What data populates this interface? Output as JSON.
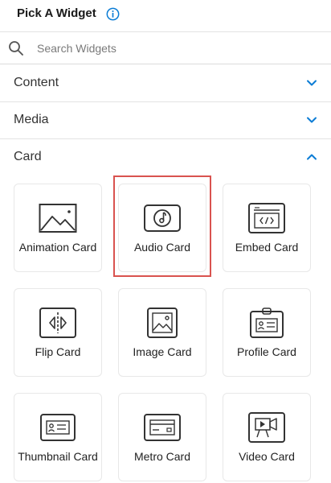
{
  "header": {
    "title": "Pick A Widget",
    "info_icon": "info-icon"
  },
  "search": {
    "placeholder": "Search Widgets",
    "value": ""
  },
  "sections": [
    {
      "label": "Content",
      "expanded": false
    },
    {
      "label": "Media",
      "expanded": false
    },
    {
      "label": "Card",
      "expanded": true
    }
  ],
  "colors": {
    "accent": "#0a7cd5",
    "highlight": "#d9534f",
    "icon": "#333333"
  },
  "cards": [
    {
      "label": "Animation Card",
      "icon": "landscape-image-icon"
    },
    {
      "label": "Audio Card",
      "icon": "music-note-icon",
      "selected": true
    },
    {
      "label": "Embed Card",
      "icon": "code-window-icon"
    },
    {
      "label": "Flip Card",
      "icon": "flip-icon"
    },
    {
      "label": "Image Card",
      "icon": "image-icon"
    },
    {
      "label": "Profile Card",
      "icon": "id-badge-icon"
    },
    {
      "label": "Thumbnail Card",
      "icon": "contact-card-icon"
    },
    {
      "label": "Metro Card",
      "icon": "credit-card-icon"
    },
    {
      "label": "Video Card",
      "icon": "video-camera-icon"
    }
  ]
}
